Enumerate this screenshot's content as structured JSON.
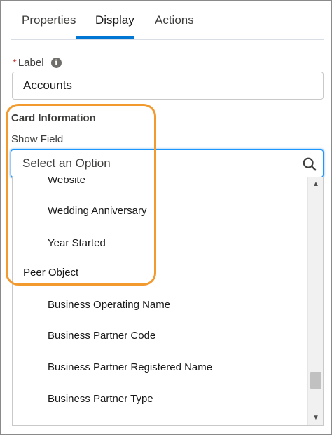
{
  "tabs": [
    {
      "label": "Properties"
    },
    {
      "label": "Display"
    },
    {
      "label": "Actions"
    }
  ],
  "label_field": {
    "required_mark": "*",
    "label": "Label",
    "info_icon": "i",
    "value": "Accounts"
  },
  "card_section": {
    "title": "Card Information",
    "show_field_label": "Show Field",
    "placeholder": "Select an Option"
  },
  "options": {
    "website": "Website",
    "wedding": "Wedding Anniversary",
    "year": "Year Started",
    "peer_group": "Peer Object",
    "biz_operating": "Business Operating Name",
    "biz_partner_code": "Business Partner Code",
    "biz_partner_reg": "Business Partner Registered Name",
    "biz_partner_type": "Business Partner Type"
  },
  "scroll": {
    "up_arrow": "▲",
    "down_arrow": "▼"
  },
  "colors": {
    "accent": "#0176d3",
    "highlight": "#f29a2e",
    "required": "#c23934"
  }
}
